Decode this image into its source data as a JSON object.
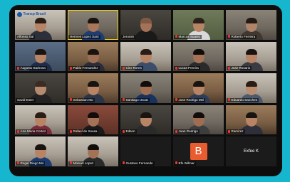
{
  "brand": {
    "logo_text": "Transp Brasil"
  },
  "participants": [
    {
      "name": "Alfonso Sal",
      "muted": false
    },
    {
      "name": "Hermes Lopez Sant",
      "muted": false,
      "active": true
    },
    {
      "name": "Jeronim",
      "muted": false
    },
    {
      "name": "Marcos Suarez",
      "muted": true
    },
    {
      "name": "Roberto Ferreira",
      "muted": true
    },
    {
      "name": "Augusto Barbosa",
      "muted": true
    },
    {
      "name": "Pablo Fernandez",
      "muted": true
    },
    {
      "name": "Ciro Torres",
      "muted": true
    },
    {
      "name": "Lucas Pereira",
      "muted": true
    },
    {
      "name": "Jose Rosario",
      "muted": true
    },
    {
      "name": "Savid Ester",
      "muted": false
    },
    {
      "name": "Sebastian Mo",
      "muted": true
    },
    {
      "name": "Santiago Uscat",
      "muted": true
    },
    {
      "name": "Jose Rodrigo Mel",
      "muted": true
    },
    {
      "name": "Eduardo Sanches",
      "muted": true
    },
    {
      "name": "Ana Maria Cortez",
      "muted": true
    },
    {
      "name": "Rafael de Sousa",
      "muted": true
    },
    {
      "name": "Edson",
      "muted": true
    },
    {
      "name": "Juan Rodrigo",
      "muted": true
    },
    {
      "name": "Ramirez",
      "muted": true
    },
    {
      "name": "Regal Diego Mo",
      "muted": true
    },
    {
      "name": "Manuel Lopez",
      "muted": true
    },
    {
      "name": "Gustavo Fernande",
      "muted": true
    },
    {
      "name": "Efe Wilmar",
      "muted": true,
      "avatar_letter": "B"
    },
    {
      "name": "Exfee K",
      "muted": false,
      "video_off": true
    }
  ]
}
